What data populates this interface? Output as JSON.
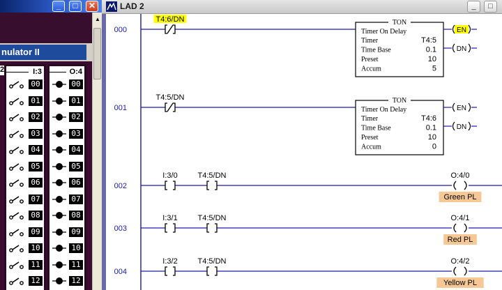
{
  "left_window": {
    "title_buttons": [
      "_",
      "□",
      "✕"
    ],
    "simulator_title": "nulator II",
    "input_header": "I:3",
    "output_header": "O:4",
    "left_header_fragment": "2",
    "channels": [
      "00",
      "01",
      "02",
      "03",
      "04",
      "05",
      "06",
      "07",
      "08",
      "09",
      "10",
      "11",
      "12"
    ]
  },
  "lad_window": {
    "title": "LAD 2",
    "title_buttons": [
      "_",
      "□"
    ],
    "colors": {
      "rung_line": "#1a1aa8",
      "text": "#000000",
      "rung_number": "#1a1aa8",
      "highlight": "#ffff00",
      "label_bg": "#f6c896"
    },
    "rungs": [
      {
        "number": "000",
        "contacts": [
          {
            "address": "T4:6/DN",
            "type": "XIO",
            "highlight": true
          }
        ],
        "timer": {
          "type_label": "TON",
          "title": "Timer On Delay",
          "fields": [
            {
              "name": "Timer",
              "value": "T4:5"
            },
            {
              "name": "Time Base",
              "value": "0.1"
            },
            {
              "name": "Preset",
              "value": "10"
            },
            {
              "name": "Accum",
              "value": "5"
            }
          ],
          "en": "EN",
          "dn": "DN",
          "en_highlight": true
        }
      },
      {
        "number": "001",
        "contacts": [
          {
            "address": "T4:5/DN",
            "type": "XIO",
            "highlight": false
          }
        ],
        "timer": {
          "type_label": "TON",
          "title": "Timer On Delay",
          "fields": [
            {
              "name": "Timer",
              "value": "T4:6"
            },
            {
              "name": "Time Base",
              "value": "0.1"
            },
            {
              "name": "Preset",
              "value": "10"
            },
            {
              "name": "Accum",
              "value": "0"
            }
          ],
          "en": "EN",
          "dn": "DN",
          "en_highlight": false
        }
      },
      {
        "number": "002",
        "contacts": [
          {
            "address": "I:3/0",
            "type": "XIC"
          },
          {
            "address": "T4:5/DN",
            "type": "XIC"
          }
        ],
        "coil": {
          "address": "O:4/0",
          "label": "Green PL"
        }
      },
      {
        "number": "003",
        "contacts": [
          {
            "address": "I:3/1",
            "type": "XIC"
          },
          {
            "address": "T4:5/DN",
            "type": "XIC"
          }
        ],
        "coil": {
          "address": "O:4/1",
          "label": "Red PL"
        }
      },
      {
        "number": "004",
        "contacts": [
          {
            "address": "I:3/2",
            "type": "XIC"
          },
          {
            "address": "T4:5/DN",
            "type": "XIC"
          }
        ],
        "coil": {
          "address": "O:4/2",
          "label": "Yellow PL"
        }
      }
    ]
  }
}
